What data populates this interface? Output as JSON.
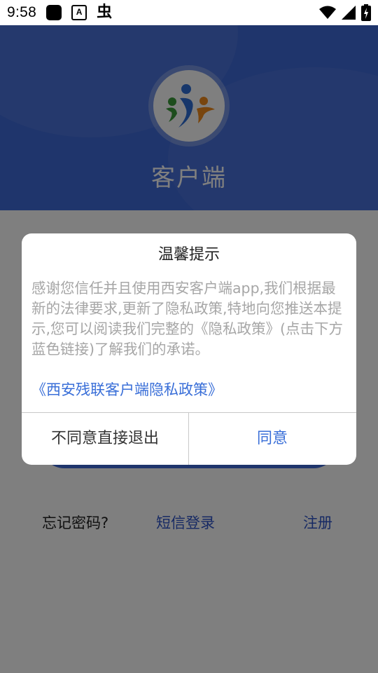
{
  "status_bar": {
    "time": "9:58",
    "icons": [
      "notification-square-icon",
      "text-a-icon",
      "bug-icon",
      "wifi-icon",
      "cellular-signal-icon",
      "battery-charging-icon"
    ]
  },
  "header": {
    "app_name": "客户端",
    "logo_icon": "people-logo-icon"
  },
  "login": {
    "forgot_password": "忘记密码?",
    "sms_login": "短信登录",
    "register": "注册"
  },
  "dialog": {
    "title": "温馨提示",
    "body": "感谢您信任并且使用西安客户端app,我们根据最新的法律要求,更新了隐私政策,特地向您推送本提示,您可以阅读我们完整的《隐私政策》(点击下方蓝色链接)了解我们的承诺。",
    "policy_link": "《西安残联客户端隐私政策》",
    "disagree_label": "不同意直接退出",
    "agree_label": "同意"
  },
  "colors": {
    "header_blue": "#3f6ad8",
    "link_blue": "#3a6fd8",
    "overlay": "rgba(0,0,0,0.5)"
  }
}
